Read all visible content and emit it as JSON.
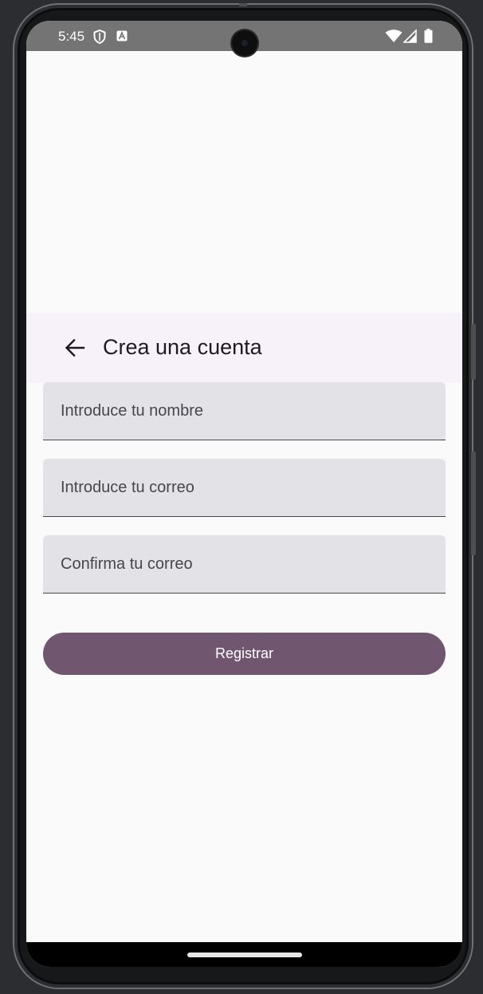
{
  "status_bar": {
    "time": "5:45",
    "left_icons": [
      "shield-icon",
      "a-letter-icon"
    ],
    "right_icons": [
      "wifi-icon",
      "signal-icon",
      "battery-icon"
    ]
  },
  "app_bar": {
    "back_icon": "arrow-left-icon",
    "title": "Crea una cuenta"
  },
  "form": {
    "name_field": {
      "placeholder": "Introduce tu nombre",
      "value": ""
    },
    "email_field": {
      "placeholder": "Introduce tu correo",
      "value": ""
    },
    "confirm_email_field": {
      "placeholder": "Confirma tu correo",
      "value": ""
    },
    "submit_label": "Registrar"
  },
  "colors": {
    "accent": "#715670",
    "field_background": "#e3e2e7",
    "app_bar_background": "#f7f2fa",
    "screen_background": "#fafafa"
  }
}
